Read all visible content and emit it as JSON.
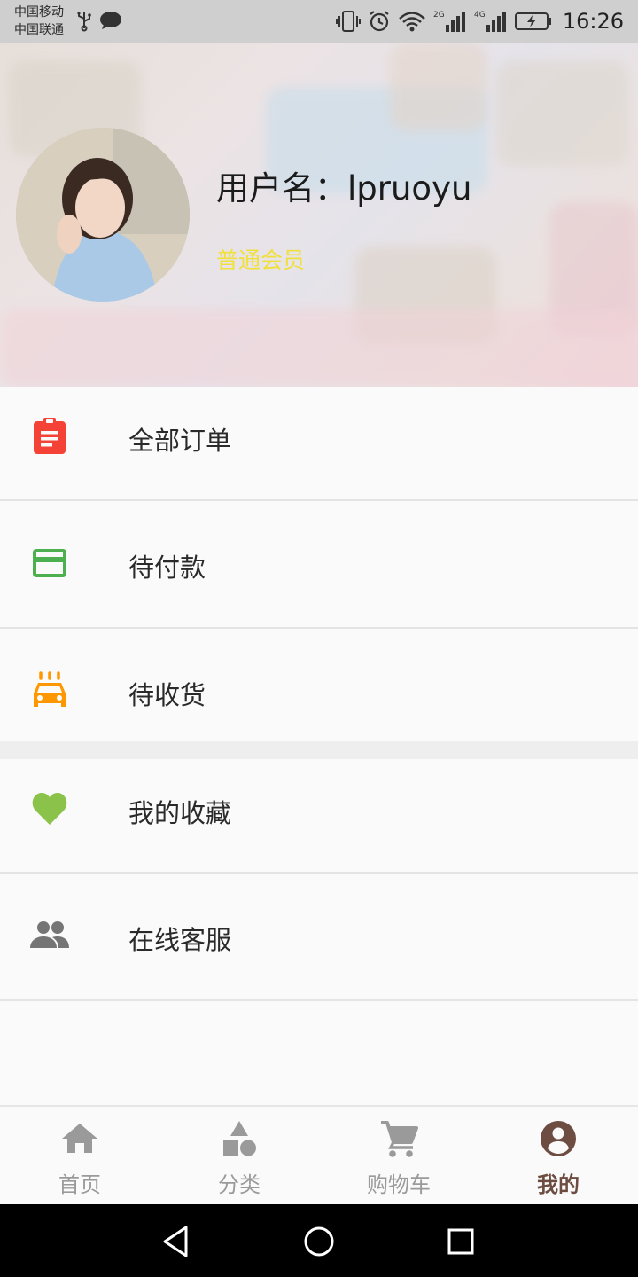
{
  "status_bar": {
    "carrier_1": "中国移动",
    "carrier_2": "中国联通",
    "time": "16:26",
    "signal_1_label": "2G",
    "signal_2_label": "4G",
    "icons": [
      "usb-icon",
      "chat-icon",
      "vibrate-icon",
      "alarm-icon",
      "wifi-icon",
      "signal-icon",
      "battery-charging-icon"
    ]
  },
  "profile": {
    "username": "用户名：lpruoyu",
    "member_level": "普通会员",
    "colors": {
      "member_level": "#f0e03a"
    }
  },
  "menu": {
    "items": [
      {
        "label": "全部订单",
        "icon": "clipboard-icon",
        "color": "#f44336"
      },
      {
        "label": "待付款",
        "icon": "credit-card-icon",
        "color": "#4caf50"
      },
      {
        "label": "待收货",
        "icon": "taxi-icon",
        "color": "#ff9800"
      },
      {
        "label": "我的收藏",
        "icon": "heart-icon",
        "color": "#8bc34a"
      },
      {
        "label": "在线客服",
        "icon": "people-icon",
        "color": "#757575"
      }
    ]
  },
  "bottom_nav": {
    "tabs": [
      {
        "label": "首页",
        "icon": "home-icon",
        "active": false
      },
      {
        "label": "分类",
        "icon": "category-icon",
        "active": false
      },
      {
        "label": "购物车",
        "icon": "cart-icon",
        "active": false
      },
      {
        "label": "我的",
        "icon": "account-icon",
        "active": true
      }
    ],
    "colors": {
      "active": "#6d4c41",
      "inactive": "#9a9a9a"
    }
  },
  "system_nav": {
    "buttons": [
      "back-icon",
      "home-circle-icon",
      "recents-icon"
    ]
  }
}
